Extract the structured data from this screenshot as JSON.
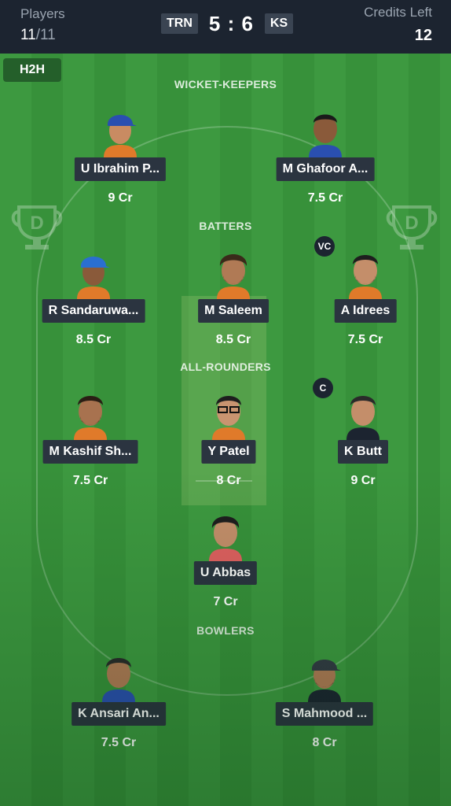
{
  "header": {
    "players_label": "Players",
    "players_count": "11",
    "players_total": "/11",
    "team_left": "TRN",
    "score": "5 : 6",
    "team_right": "KS",
    "credits_label": "Credits Left",
    "credits_value": "12"
  },
  "field": {
    "tab_label": "H2H",
    "sections": {
      "wicket_keepers": "WICKET-KEEPERS",
      "batters": "BATTERS",
      "all_rounders": "ALL-ROUNDERS",
      "bowlers": "BOWLERS"
    },
    "vc_badge": "VC",
    "c_badge": "C"
  },
  "players": {
    "wk1": {
      "name": "U Ibrahim P...",
      "credits": "9 Cr",
      "jersey": "#e07a2a",
      "cap": "#2a4fb0"
    },
    "wk2": {
      "name": "M Ghafoor A...",
      "credits": "7.5 Cr",
      "jersey": "#2a4fb0"
    },
    "bat1": {
      "name": "R Sandaruwa...",
      "credits": "8.5 Cr",
      "jersey": "#e07a2a",
      "cap": "#2a6fd0"
    },
    "bat2": {
      "name": "M Saleem",
      "credits": "8.5 Cr",
      "jersey": "#e07a2a"
    },
    "bat3": {
      "name": "A Idrees",
      "credits": "7.5 Cr",
      "jersey": "#e07a2a"
    },
    "ar1": {
      "name": "M Kashif Sh...",
      "credits": "7.5 Cr",
      "jersey": "#e07a2a"
    },
    "ar2": {
      "name": "Y Patel",
      "credits": "8 Cr",
      "jersey": "#e07a2a"
    },
    "ar3": {
      "name": "K Butt",
      "credits": "9 Cr",
      "jersey": "#1c2430"
    },
    "ar4": {
      "name": "U Abbas",
      "credits": "7 Cr",
      "jersey": "#e06060"
    },
    "bowl1": {
      "name": "K Ansari An...",
      "credits": "7.5 Cr",
      "jersey": "#2a4fb0"
    },
    "bowl2": {
      "name": "S Mahmood ...",
      "credits": "8 Cr",
      "jersey": "#1c2430",
      "cap": "#333a44"
    }
  }
}
